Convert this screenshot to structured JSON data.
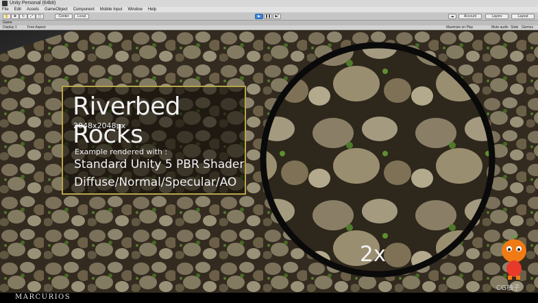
{
  "window": {
    "title": "Unity Personal (64bit)"
  },
  "menu": [
    "File",
    "Edit",
    "Assets",
    "GameObject",
    "Component",
    "Mobile Input",
    "Window",
    "Help"
  ],
  "toolbar": {
    "pivot": "Center",
    "space": "Local",
    "account": "Account",
    "layers": "Layers",
    "layout": "Layout"
  },
  "tab": {
    "label": "Game"
  },
  "game_bar": {
    "display": "Display 1",
    "aspect": "Free Aspect",
    "maximize": "Maximize on Play",
    "mute": "Mute audio",
    "stats": "Stats",
    "gizmos": "Gizmos"
  },
  "overlay": {
    "title": "Riverbed Rocks",
    "resolution": "2048x2048px",
    "example": "Example rendered with :",
    "shader": "Standard Unity 5 PBR Shader",
    "maps": "Diffuse/Normal/Specular/AO",
    "zoom": "2x",
    "panel_border_color": "#b8a84a"
  },
  "footer": {
    "brand": "MARCURIOS"
  },
  "watermark": {
    "text": "CG柚子"
  }
}
